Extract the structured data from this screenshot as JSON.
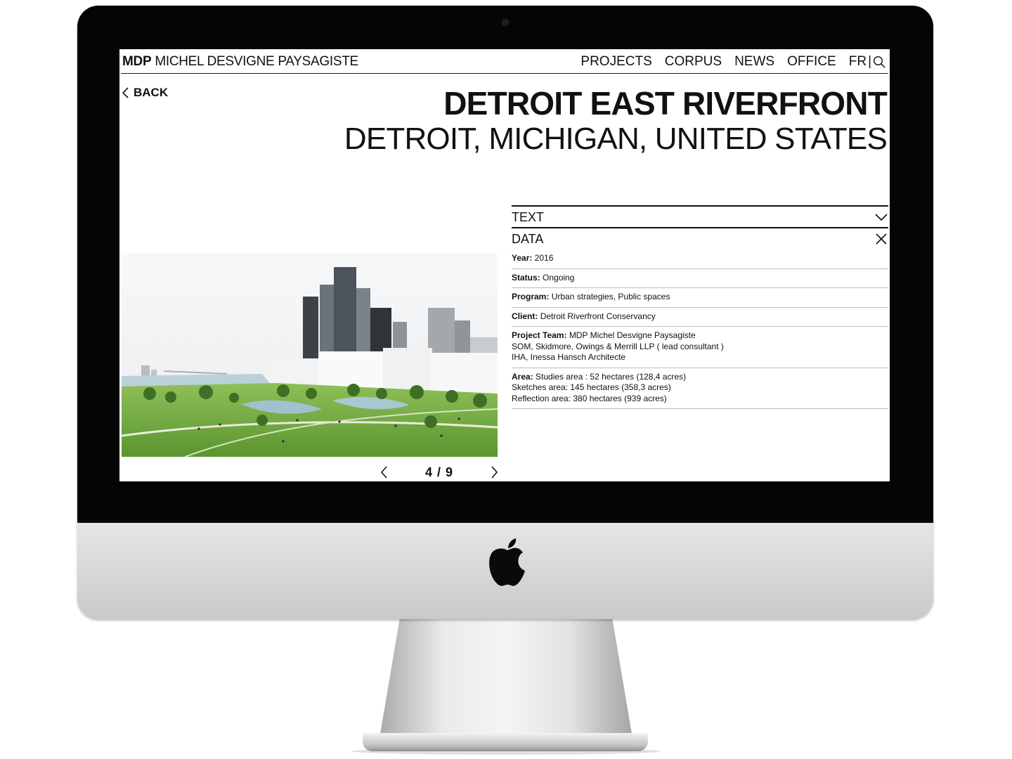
{
  "site": {
    "brand_abbr": "MDP",
    "brand_full": "MICHEL DESVIGNE PAYSAGISTE",
    "nav": [
      "PROJECTS",
      "CORPUS",
      "NEWS",
      "OFFICE"
    ],
    "lang": "FR",
    "lang_separator": "|"
  },
  "page": {
    "back_label": "BACK",
    "title": "DETROIT EAST RIVERFRONT",
    "subtitle": "DETROIT, MICHIGAN, UNITED STATES"
  },
  "gallery": {
    "counter": "4 / 9",
    "current": 4,
    "total": 9
  },
  "accordion": {
    "text_label": "TEXT",
    "data_label": "DATA",
    "year_key": "Year:",
    "year_value": "2016",
    "status_key": "Status:",
    "status_value": "Ongoing",
    "program_key": "Program:",
    "program_value": "Urban strategies, Public spaces",
    "client_key": "Client:",
    "client_value": "Detroit Riverfront Conservancy",
    "team_key": "Project Team:",
    "team_line1": "MDP Michel Desvigne Paysagiste",
    "team_line2": "SOM, Skidmore, Owings & Merrill LLP ( lead consultant )",
    "team_line3": "IHA, Inessa Hansch Architecte",
    "area_key": "Area:",
    "area_line1": "Studies area : 52 hectares (128,4 acres)",
    "area_line2": "Sketches area: 145 hectares (358,3 acres)",
    "area_line3": "Reflection area: 380 hectares (939 acres)"
  },
  "icons": {
    "back": "chevron-left-icon",
    "search": "search-icon",
    "text_toggle": "chevron-down-icon",
    "data_toggle": "close-icon",
    "prev": "chevron-left-icon",
    "next": "chevron-right-icon",
    "device_logo": "apple-logo-icon"
  },
  "colors": {
    "text": "#111111",
    "screen_bg": "#ffffff",
    "bezel": "#050505",
    "aluminum": "#d4d5d7",
    "grass": "#6fa83a"
  }
}
